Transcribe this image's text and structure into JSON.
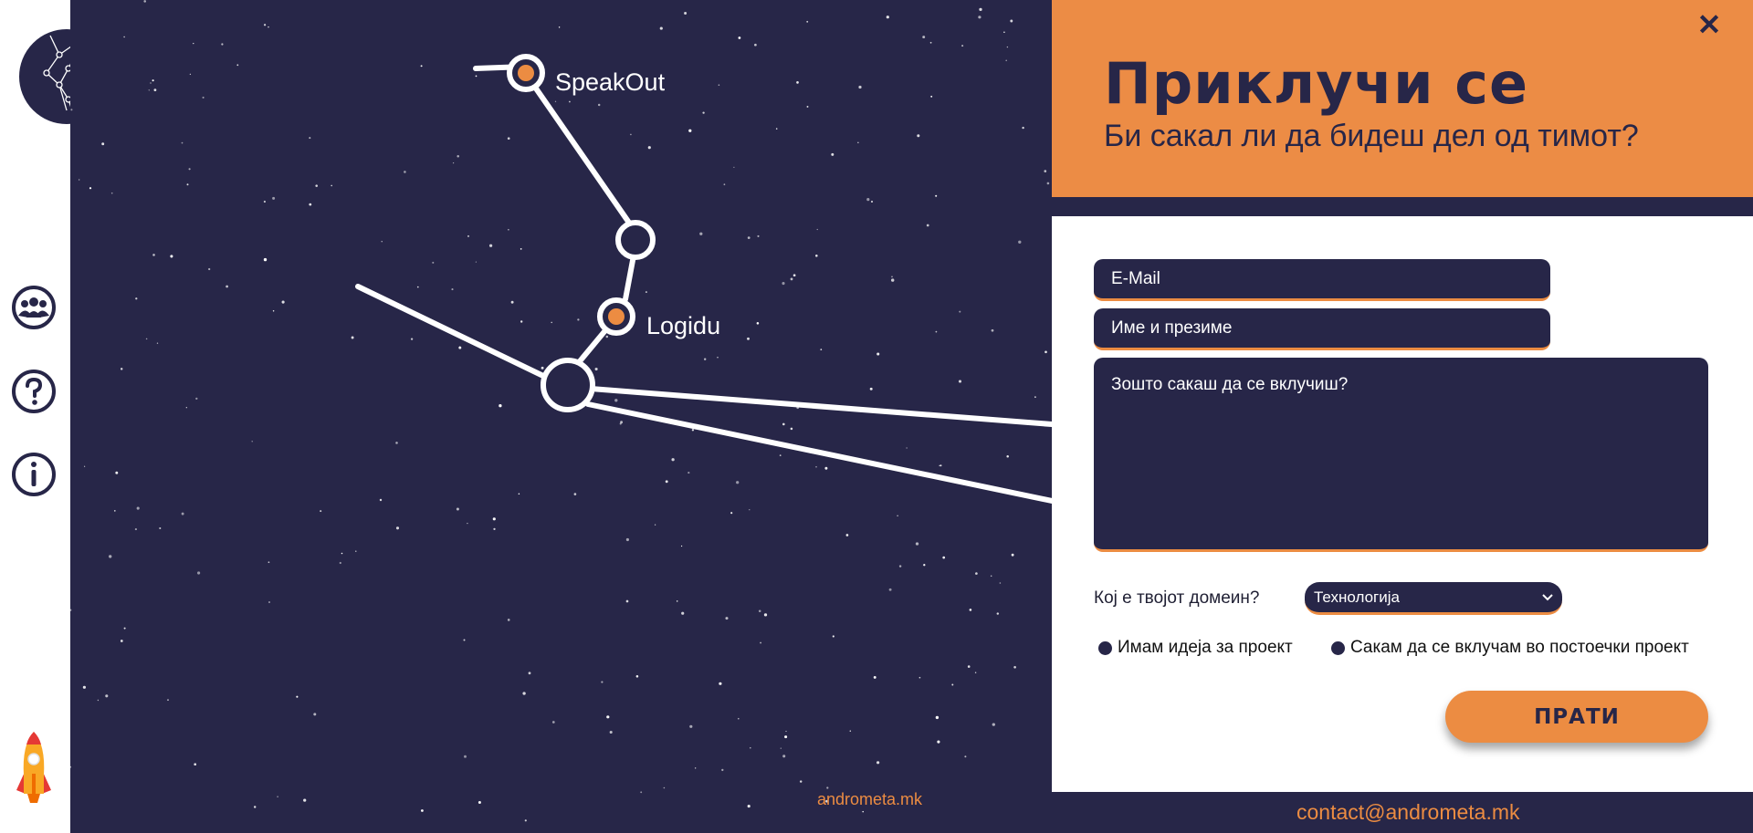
{
  "colors": {
    "background": "#272648",
    "accent": "#ec8c42",
    "sidebar": "#ffffff"
  },
  "sidebar": {
    "logo_icon": "constellation-logo-icon",
    "buttons": [
      {
        "name": "team",
        "icon": "team-icon"
      },
      {
        "name": "help",
        "icon": "question-icon"
      },
      {
        "name": "info",
        "icon": "info-icon"
      }
    ],
    "rocket_icon": "rocket-icon"
  },
  "map": {
    "nodes": [
      {
        "label": "SpeakOut"
      },
      {
        "label": "Logidu"
      }
    ],
    "footer_site": "andrometa.mk"
  },
  "panel": {
    "close_icon": "close-icon",
    "title": "Приклучи се",
    "subtitle": "Би сакал ли да бидеш дел од тимот?",
    "form": {
      "email_placeholder": "E-Mail",
      "name_placeholder": "Име и презиме",
      "why_placeholder": "Зошто сакаш да се вклучиш?",
      "domain_label": "Кој е твојот домеин?",
      "domain_selected": "Технологија",
      "radio_options": [
        "Имам идеја за проект",
        "Сакам да се вклучам во постоечки проект"
      ],
      "submit_label": "ПРАТИ"
    },
    "contact": "contact@andrometa.mk"
  }
}
